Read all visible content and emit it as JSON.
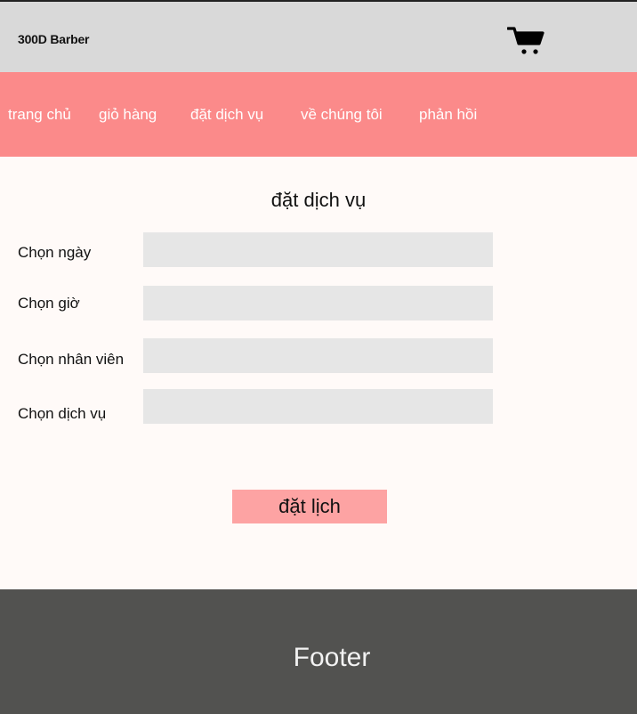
{
  "header": {
    "brand": "300D Barber",
    "cart_icon": "shopping-cart-icon"
  },
  "nav": {
    "items": [
      {
        "label": "trang chủ"
      },
      {
        "label": "giỏ hàng"
      },
      {
        "label": "đặt dịch vụ"
      },
      {
        "label": "về chúng tôi"
      },
      {
        "label": "phản hồi"
      }
    ]
  },
  "form": {
    "title": "đặt dịch vụ",
    "fields": [
      {
        "label": "Chọn ngày",
        "value": ""
      },
      {
        "label": "Chọn giờ",
        "value": ""
      },
      {
        "label": "Chọn nhân viên",
        "value": ""
      },
      {
        "label": "Chọn dịch vụ",
        "value": ""
      }
    ],
    "submit_label": "đặt lịch"
  },
  "footer": {
    "text": "Footer"
  },
  "colors": {
    "header_bg": "#d9d9d9",
    "nav_bg": "#fb8a8a",
    "input_bg": "#e6e6e6",
    "button_bg": "#fda3a3",
    "footer_bg": "#525250"
  }
}
